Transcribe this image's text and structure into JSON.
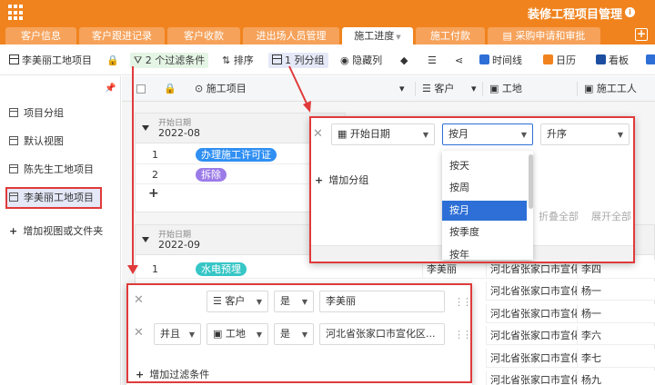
{
  "app": {
    "title": "装修工程项目管理"
  },
  "tabs": [
    {
      "label": "客户信息"
    },
    {
      "label": "客户跟进记录"
    },
    {
      "label": "客户收款"
    },
    {
      "label": "进出场人员管理"
    },
    {
      "label": "施工进度"
    },
    {
      "label": "施工付款"
    },
    {
      "label": "采购申请和审批"
    }
  ],
  "toolbar": {
    "view_name": "李美丽工地项目",
    "filter": "2 个过滤条件",
    "sort": "排序",
    "group": "1 列分组",
    "hide": "隐藏列",
    "timeline": "时间线",
    "calendar": "日历",
    "kanban": "看板"
  },
  "sidebar": {
    "items": [
      {
        "label": "项目分组"
      },
      {
        "label": "默认视图"
      },
      {
        "label": "陈先生工地项目"
      },
      {
        "label": "李美丽工地项目"
      }
    ],
    "add_label": "增加视图或文件夹"
  },
  "columns": {
    "task": "施工项目",
    "customer": "客户",
    "site": "工地",
    "worker": "施工工人"
  },
  "groups": [
    {
      "label": "开始日期",
      "value": "2022-08",
      "rows": [
        {
          "n": "1",
          "task": "办理施工许可证",
          "color": "#2f8ff2"
        },
        {
          "n": "2",
          "task": "拆除",
          "color": "#9b7be8"
        }
      ]
    },
    {
      "label": "开始日期",
      "value": "2022-09",
      "rows": [
        {
          "n": "1",
          "task": "水电预埋",
          "color": "#37c6c6"
        }
      ]
    }
  ],
  "bg_rows": [
    {
      "customer": "李美丽",
      "site": "河北省张家口市宣化",
      "worker": "李四"
    },
    {
      "customer": "",
      "site": "河北省张家口市宣化",
      "worker": "杨一"
    },
    {
      "customer": "",
      "site": "河北省张家口市宣化",
      "worker": "杨一"
    },
    {
      "customer": "",
      "site": "河北省张家口市宣化",
      "worker": "李六"
    },
    {
      "customer": "",
      "site": "河北省张家口市宣化",
      "worker": "李七"
    },
    {
      "customer": "",
      "site": "河北省张家口市宣化",
      "worker": "杨九"
    }
  ],
  "group_popup": {
    "field": "开始日期",
    "granularity": "按月",
    "order": "升序",
    "add_group": "增加分组",
    "collapse_all": "折叠全部",
    "expand_all": "展开全部",
    "options": [
      "按天",
      "按周",
      "按月",
      "按季度",
      "按年"
    ]
  },
  "filter_popup": {
    "conditions": [
      {
        "conj": "",
        "field": "客户",
        "op": "是",
        "value": "李美丽"
      },
      {
        "conj": "并且",
        "field": "工地",
        "op": "是",
        "value": "河北省张家口市宣化区..."
      }
    ],
    "add_filter": "增加过滤条件"
  },
  "colors": {
    "accent": "#f0831e",
    "highlight": "#e03a3a",
    "primary": "#2d6fd6"
  }
}
